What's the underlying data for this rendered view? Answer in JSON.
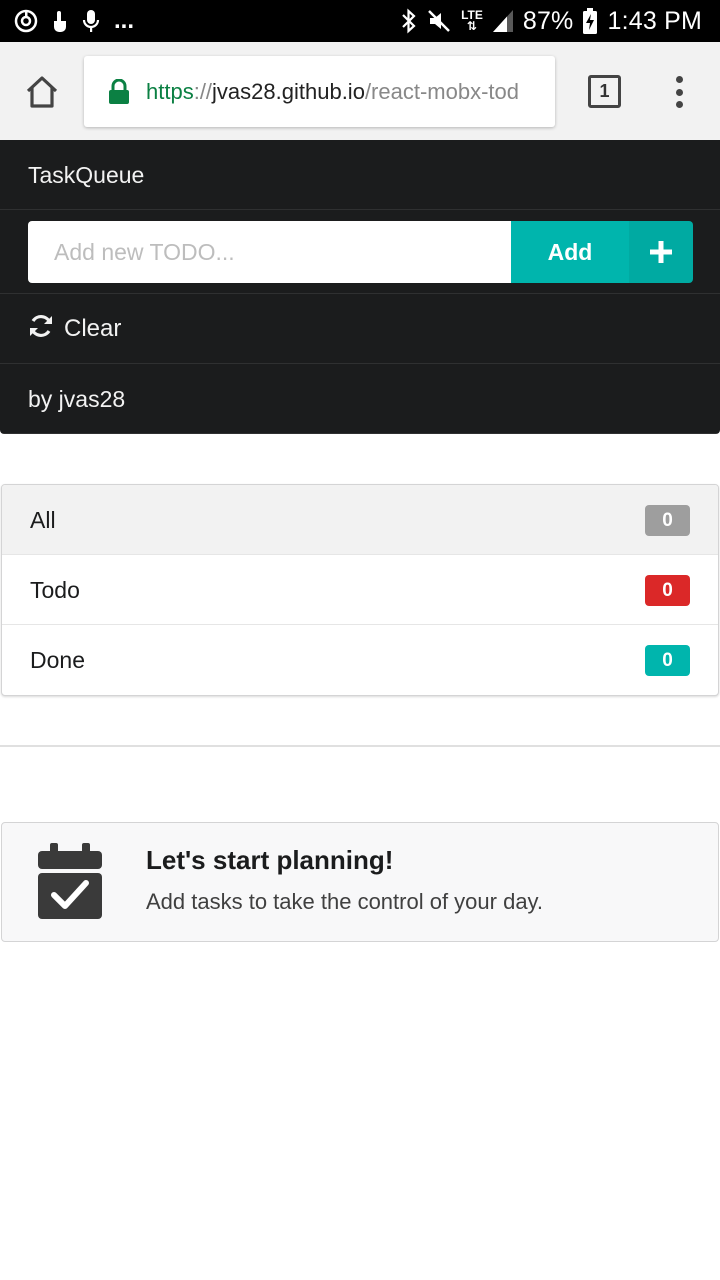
{
  "status_bar": {
    "battery": "87%",
    "time": "1:43 PM",
    "network": "LTE",
    "overflow": "..."
  },
  "browser": {
    "url_scheme": "https",
    "url_sep": "://",
    "url_host": "jvas28.github.io",
    "url_path": "/react-mobx-tod",
    "tab_count": "1"
  },
  "app": {
    "brand": "TaskQueue",
    "input_placeholder": "Add new TODO...",
    "add_label": "Add",
    "clear_label": "Clear",
    "author": "by jvas28"
  },
  "filters": [
    {
      "label": "All",
      "count": "0",
      "color": "#9e9e9e"
    },
    {
      "label": "Todo",
      "count": "0",
      "color": "#db2828"
    },
    {
      "label": "Done",
      "count": "0",
      "color": "#00b5ad"
    }
  ],
  "empty_state": {
    "title": "Let's start planning!",
    "body": "Add tasks to take the control of your day."
  },
  "colors": {
    "accent": "#00b5ad",
    "header_bg": "#1b1c1d",
    "secure": "#0b8043"
  }
}
